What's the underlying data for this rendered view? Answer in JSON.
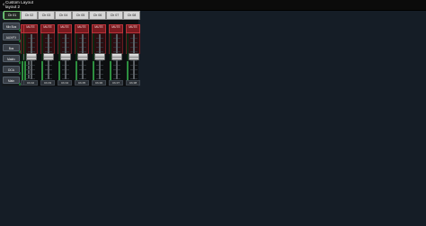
{
  "header": {
    "back_icon": "chevron-left-icon",
    "title": "Custom Layout",
    "subtitle": "layout 2"
  },
  "side_panel": {
    "items": [
      {
        "label": "Ch In",
        "active": true
      },
      {
        "label": "Mix Bus"
      },
      {
        "label": "AUX/FX"
      },
      {
        "label": "Bus"
      },
      {
        "label": "Matrix"
      },
      {
        "label": "DCA"
      },
      {
        "label": "Main"
      }
    ]
  },
  "channels": [
    {
      "tab": "Ch 01",
      "mute_label": "MUTE",
      "name": "Ch 01",
      "level": 0.7,
      "active": true
    },
    {
      "tab": "Ch 02",
      "mute_label": "MUTE",
      "name": "Ch 02",
      "level": 0.7
    },
    {
      "tab": "Ch 03",
      "mute_label": "MUTE",
      "name": "Ch 03",
      "level": 0.7
    },
    {
      "tab": "Ch 04",
      "mute_label": "MUTE",
      "name": "Ch 04",
      "level": 0.7
    },
    {
      "tab": "Ch 05",
      "mute_label": "MUTE",
      "name": "Ch 05",
      "level": 0.7
    },
    {
      "tab": "Ch 06",
      "mute_label": "MUTE",
      "name": "Ch 06",
      "level": 0.7
    },
    {
      "tab": "Ch 07",
      "mute_label": "MUTE",
      "name": "Ch 07",
      "level": 0.7
    },
    {
      "tab": "Ch 08",
      "mute_label": "MUTE",
      "name": "Ch 08",
      "level": 0.7
    }
  ],
  "colors": {
    "background": "#151d26",
    "mute_red": "#7a1a1f",
    "meter_green": "#2d8f3f",
    "active_accent": "#58b26d"
  }
}
